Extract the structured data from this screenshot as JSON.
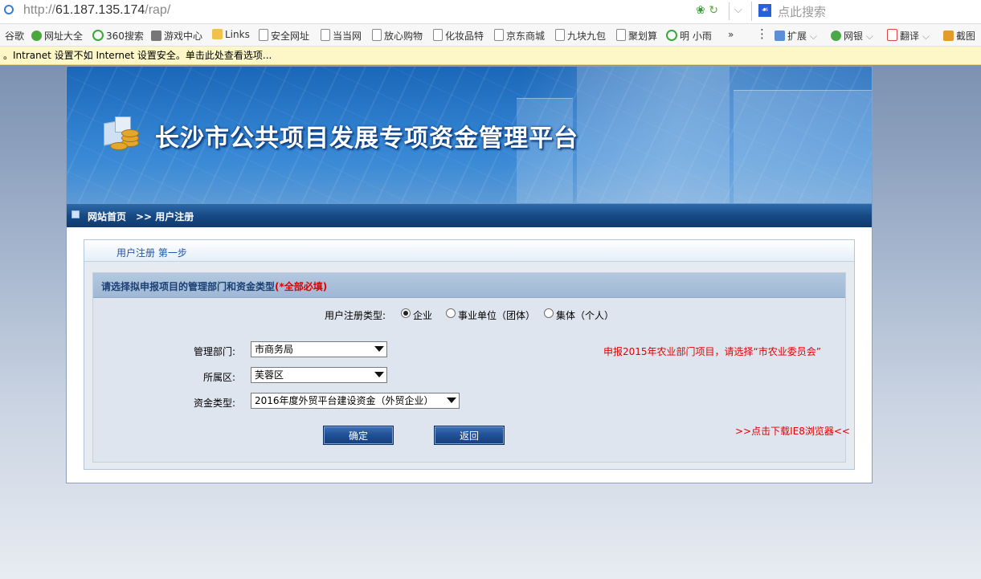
{
  "browser": {
    "url_prefix": "http://",
    "url_host": "61.187.135.174",
    "url_path": "/rap/",
    "search_placeholder": "点此搜索",
    "favorites": [
      "谷歌",
      "网址大全",
      "360搜索",
      "游戏中心",
      "Links",
      "安全网址",
      "当当网",
      "放心购物",
      "化妆品特",
      "京东商城",
      "九块九包",
      "聚划算",
      "明 小雨",
      "»",
      "扩展",
      "网银",
      "翻译",
      "截图"
    ],
    "info_bar": "。Intranet 设置不如 Internet 设置安全。单击此处查看选项..."
  },
  "site": {
    "title": "长沙市公共项目发展专项资金管理平台",
    "nav_home": "网站首页",
    "nav_crumb": ">> 用户注册"
  },
  "form": {
    "step_title": "用户注册  第一步",
    "section_title": "请选择拟申报项目的管理部门和资金类型",
    "required_note": "(*全部必填)",
    "type_label": "用户注册类型:",
    "type_options": [
      "企业",
      "事业单位（团体）",
      "集体（个人）"
    ],
    "selected_type": "企业",
    "dept_label": "管理部门:",
    "dept_value": "市商务局",
    "district_label": "所属区:",
    "district_value": "芙蓉区",
    "fund_label": "资金类型:",
    "fund_value": "2016年度外贸平台建设资金（外贸企业）",
    "hint": "申报2015年农业部门项目，请选择“市农业委员会”",
    "confirm": "确定",
    "back": "返回",
    "download_link": ">>点击下载IE8浏览器<<"
  },
  "colors": {
    "nav_bg": "#174a85",
    "required": "#e00000",
    "button": "#1f4f95"
  }
}
